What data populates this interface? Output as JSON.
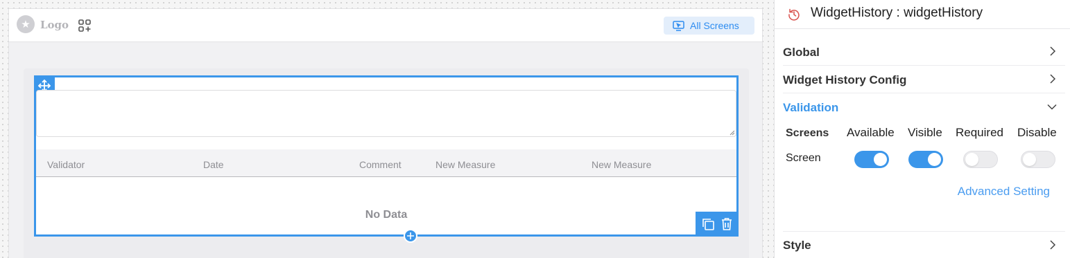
{
  "canvas": {
    "logo_text": "Logo",
    "all_screens_label": "All Screens"
  },
  "widget": {
    "table_headers": [
      "Validator",
      "Date",
      "Comment",
      "New Measure",
      "New Measure"
    ],
    "empty_text": "No Data"
  },
  "panel": {
    "title": "WidgetHistory : widgetHistory",
    "sections": {
      "global": "Global",
      "config": "Widget History Config",
      "validation": "Validation",
      "style": "Style"
    },
    "validation": {
      "columns": [
        "Screens",
        "Available",
        "Visible",
        "Required",
        "Disable"
      ],
      "row_label": "Screen",
      "toggles": {
        "available": true,
        "visible": true,
        "required": false,
        "disable": false
      },
      "advanced_label": "Advanced Setting"
    }
  },
  "colors": {
    "accent": "#3b96ea",
    "muted_text": "#8e8e93"
  },
  "icons": [
    "star-icon",
    "apps-add-icon",
    "monitor-cursor-icon",
    "move-arrows-icon",
    "resize-grip-icon",
    "copy-icon",
    "trash-icon",
    "plus-icon",
    "history-icon",
    "chevron-right-icon",
    "chevron-down-icon"
  ]
}
